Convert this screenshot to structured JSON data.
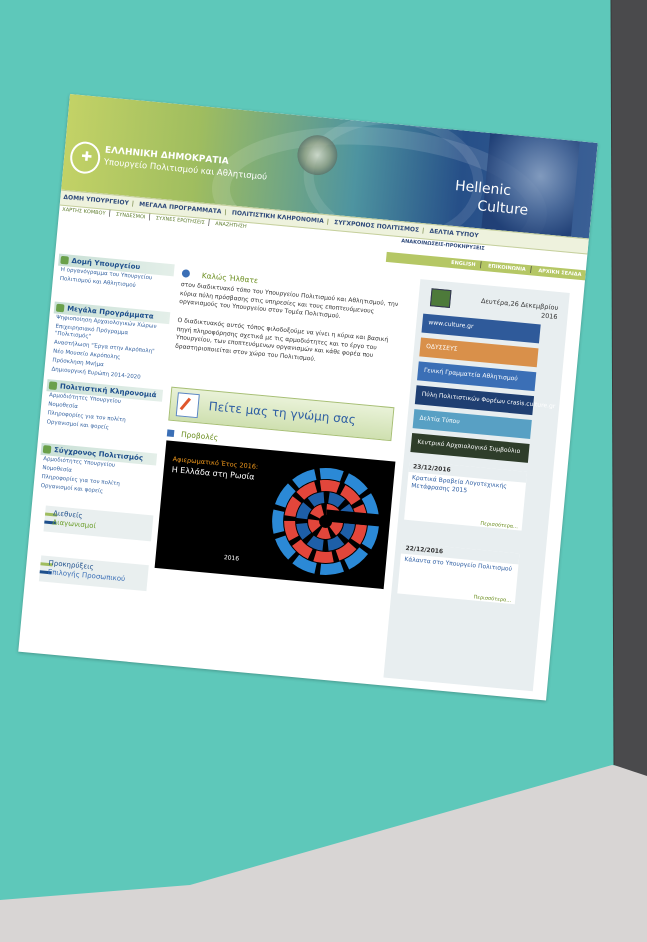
{
  "header": {
    "govt_line1": "ΕΛΛΗΝΙΚΗ ΔΗΜΟΚΡΑΤΙΑ",
    "govt_line2": "Υπουργείο Πολιτισμού και Αθλητισμού",
    "brand_line1": "Hellenic",
    "brand_line2": "Culture"
  },
  "nav": {
    "items": [
      "ΔΟΜΗ ΥΠΟΥΡΓΕΙΟΥ",
      "ΜΕΓΑΛΑ ΠΡΟΓΡΑΜΜΑΤΑ",
      "ΠΟΛΙΤΙΣΤΙΚΗ ΚΛΗΡΟΝΟΜΙΑ",
      "ΣΥΓΧΡΟΝΟΣ ΠΟΛΙΤΙΣΜΟΣ",
      "ΔΕΛΤΙΑ ΤΥΠΟΥ"
    ],
    "subitems": [
      "ΧΑΡΤΗΣ ΚΟΜΒΟΥ",
      "ΣΥΝΔΕΣΜΟΙ",
      "ΣΥΧΝΕΣ ΕΡΩΤΗΣΕΙΣ",
      "ΑΝΑΖΗΤΗΣΗ"
    ],
    "extra": "ΑΝΑΚΟΙΝΩΣΕΙΣ-ΠΡΟΚΗΡΥΞΕΙΣ",
    "lang": [
      "ENGLISH",
      "ΕΠΙΚΟΙΝΩΝΙΑ",
      "ΑΡΧΙΚΗ ΣΕΛΙΔΑ"
    ]
  },
  "sidebar": {
    "sections": [
      {
        "title": "Δομή Υπουργείου",
        "links": [
          "Η οργανόγραμμα του Υπουργείου",
          "Πολιτισμού και Αθλητισμού"
        ]
      },
      {
        "title": "Μεγάλα Προγράμματα",
        "links": [
          "Ψηφιοποίηση Αρχαιολογικών Χώρων",
          "Επιχειρησιακό Πρόγραμμα \"Πολιτισμός\"",
          "Αναστήλωση \"Έργα στην Ακρόπολη\"",
          "Νέο Μουσείο Ακρόπολης",
          "Πρόσκληση Μνήμα",
          "Δημιουργική Ευρώπη 2014-2020"
        ]
      },
      {
        "title": "Πολιτιστική Κληρονομιά",
        "links": [
          "Αρμοδιότητες Υπουργείου",
          "Νομοθεσία",
          "Πληροφορίες για τον πολίτη",
          "Οργανισμοί και φορείς"
        ]
      },
      {
        "title": "Σύγχρονος Πολιτισμός",
        "links": [
          "Αρμοδιότητες Υπουργείου",
          "Νομοθεσία",
          "Πληροφορίες για τον πολίτη",
          "Οργανισμοί και φορείς"
        ]
      }
    ],
    "mini1": {
      "title": "Διεθνείς",
      "sub": "Διαγωνισμοί"
    },
    "mini2": {
      "title": "Προκηρύξεις",
      "sub": "Επιλογής Προσωπικού"
    }
  },
  "center": {
    "welcome_title": "Καλώς Ήλθατε",
    "welcome_p1": "στον διαδικτυακό τόπο του Υπουργείου Πολιτισμού και Αθλητισμού, την κύρια πύλη πρόσβασης στις υπηρεσίες και τους εποπτευόμενους οργανισμούς του Υπουργείου στον Τομέα Πολιτισμού.",
    "welcome_p2": "Ο διαδικτυακός αυτός τόπος φιλοδοξούμε να γίνει η κύρια και βασική πηγή πληροφόρησης σχετικά με τις αρμοδιότητες και το έργο του Υπουργείου, των εποπτευόμενων οργανισμών και κάθε φορέα που δραστηριοποιείται στον χώρο του Πολιτισμού.",
    "opinion": "Πείτε μας τη γνώμη σας",
    "proboles_title": "Προβολές",
    "video_line1": "Αφιερωματικό Έτος 2016:",
    "video_line2": "Η Ελλάδα στη Ρωσία",
    "video_logo": "2016"
  },
  "right": {
    "date": "Δευτέρα,26 Δεκεμβρίου 2016",
    "banners": [
      {
        "label": "www.culture.gr",
        "color": "#2f5a9a"
      },
      {
        "label": "ΟΔΥΣΣΕΥΣ",
        "color": "#d9904a"
      },
      {
        "label": "Γενική Γραμματεία Αθλητισμού",
        "color": "#3b6fb6"
      },
      {
        "label": "Πύλη Πολιτιστικών Φορέων  crasis.culture.gr",
        "color": "#1f3f72"
      },
      {
        "label": "Δελτία Τύπου",
        "color": "#58a0c4"
      },
      {
        "label": "Κεντρικό Αρχαιολογικό Συμβούλιο",
        "color": "#2e3d2a"
      }
    ],
    "news": [
      {
        "date": "23/12/2016",
        "text": "Κρατικά Βραβεία Λογοτεχνικής Μετάφρασης 2015",
        "more": "Περισσότερα..."
      },
      {
        "date": "22/12/2016",
        "text": "Κάλαντα στο Υπουργείο Πολιτισμού",
        "more": "Περισσότερα..."
      }
    ]
  },
  "colors": {
    "wall": "#5ec8ba",
    "accent_green": "#6b8e1f",
    "accent_blue": "#2f5fa3"
  }
}
